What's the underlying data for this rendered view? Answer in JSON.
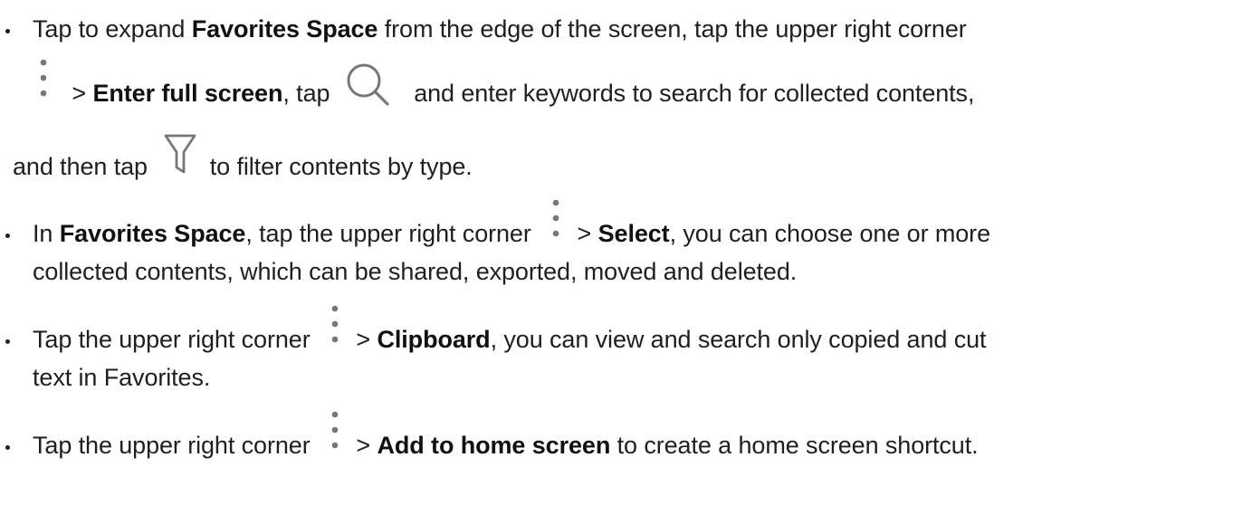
{
  "items": [
    {
      "lines": [
        {
          "t1": "Tap to expand ",
          "b1": "Favorites Space",
          "t2": " from the edge of the screen, tap the upper right corner"
        },
        {
          "icon1": "more-vertical-icon",
          "t1": " > ",
          "b1": "Enter full screen",
          "t2": ", tap ",
          "icon2": "search-icon",
          "t3": " and enter keywords to search for collected contents,"
        },
        {
          "t1": "and then tap ",
          "icon1": "filter-icon",
          "t2": " to filter contents by type."
        }
      ]
    },
    {
      "lines": [
        {
          "t1": "In ",
          "b1": "Favorites Space",
          "t2": ", tap the upper right corner ",
          "icon1": "more-vertical-icon",
          "t3": " > ",
          "b2": "Select",
          "t4": ", you can choose one or more"
        },
        {
          "t1": "collected contents, which can be shared, exported, moved and deleted."
        }
      ]
    },
    {
      "lines": [
        {
          "t1": "Tap the upper right corner ",
          "icon1": "more-vertical-icon",
          "t2": " > ",
          "b1": "Clipboard",
          "t3": ", you can view and search only copied and cut"
        },
        {
          "t1": "text in Favorites."
        }
      ]
    },
    {
      "lines": [
        {
          "t1": "Tap the upper right corner ",
          "icon1": "more-vertical-icon",
          "t2": " > ",
          "b1": "Add to home screen",
          "t3": " to create a home screen shortcut."
        }
      ]
    }
  ]
}
